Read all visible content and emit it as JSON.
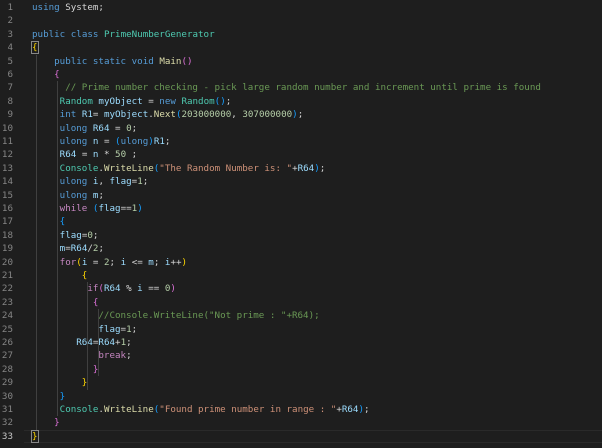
{
  "editor": {
    "line_numbers": [
      "1",
      "2",
      "3",
      "4",
      "5",
      "6",
      "7",
      "8",
      "9",
      "10",
      "11",
      "12",
      "13",
      "14",
      "15",
      "16",
      "17",
      "18",
      "19",
      "20",
      "21",
      "22",
      "23",
      "24",
      "25",
      "26",
      "27",
      "28",
      "29",
      "30",
      "31",
      "32",
      "33"
    ],
    "lines": [
      [
        {
          "t": "using",
          "c": "kw"
        },
        {
          "t": " System;",
          "c": ""
        }
      ],
      [],
      [
        {
          "t": "public",
          "c": "kw"
        },
        {
          "t": " ",
          "c": ""
        },
        {
          "t": "class",
          "c": "kw"
        },
        {
          "t": " ",
          "c": ""
        },
        {
          "t": "PrimeNumberGenerator",
          "c": "type"
        }
      ],
      [
        {
          "t": "{",
          "c": "br1 bracket-box"
        }
      ],
      [
        {
          "t": "    ",
          "c": ""
        },
        {
          "t": "public",
          "c": "kw"
        },
        {
          "t": " ",
          "c": ""
        },
        {
          "t": "static",
          "c": "kw"
        },
        {
          "t": " ",
          "c": ""
        },
        {
          "t": "void",
          "c": "kw"
        },
        {
          "t": " ",
          "c": ""
        },
        {
          "t": "Main",
          "c": "fn"
        },
        {
          "t": "()",
          "c": "br2"
        }
      ],
      [
        {
          "t": "    ",
          "c": ""
        },
        {
          "t": "{",
          "c": "br2"
        }
      ],
      [
        {
          "t": "      ",
          "c": ""
        },
        {
          "t": "// Prime number checking - pick large random number and increment until prime is found",
          "c": "cm"
        }
      ],
      [
        {
          "t": "     ",
          "c": ""
        },
        {
          "t": "Random",
          "c": "type"
        },
        {
          "t": " ",
          "c": ""
        },
        {
          "t": "myObject",
          "c": "var"
        },
        {
          "t": " = ",
          "c": ""
        },
        {
          "t": "new",
          "c": "kw"
        },
        {
          "t": " ",
          "c": ""
        },
        {
          "t": "Random",
          "c": "type"
        },
        {
          "t": "()",
          "c": "br3"
        },
        {
          "t": ";",
          "c": ""
        }
      ],
      [
        {
          "t": "     ",
          "c": ""
        },
        {
          "t": "int",
          "c": "kw"
        },
        {
          "t": " ",
          "c": ""
        },
        {
          "t": "R1",
          "c": "var"
        },
        {
          "t": "= ",
          "c": ""
        },
        {
          "t": "myObject",
          "c": "var"
        },
        {
          "t": ".",
          "c": ""
        },
        {
          "t": "Next",
          "c": "fn"
        },
        {
          "t": "(",
          "c": "br3"
        },
        {
          "t": "203000000",
          "c": "num"
        },
        {
          "t": ", ",
          "c": ""
        },
        {
          "t": "307000000",
          "c": "num"
        },
        {
          "t": ")",
          "c": "br3"
        },
        {
          "t": ";",
          "c": ""
        }
      ],
      [
        {
          "t": "     ",
          "c": ""
        },
        {
          "t": "ulong",
          "c": "kw"
        },
        {
          "t": " ",
          "c": ""
        },
        {
          "t": "R64",
          "c": "var"
        },
        {
          "t": " = ",
          "c": ""
        },
        {
          "t": "0",
          "c": "num"
        },
        {
          "t": ";",
          "c": ""
        }
      ],
      [
        {
          "t": "     ",
          "c": ""
        },
        {
          "t": "ulong",
          "c": "kw"
        },
        {
          "t": " ",
          "c": ""
        },
        {
          "t": "n",
          "c": "var"
        },
        {
          "t": " = ",
          "c": ""
        },
        {
          "t": "(",
          "c": "br3"
        },
        {
          "t": "ulong",
          "c": "kw"
        },
        {
          "t": ")",
          "c": "br3"
        },
        {
          "t": "R1",
          "c": "var"
        },
        {
          "t": ";",
          "c": ""
        }
      ],
      [
        {
          "t": "     ",
          "c": ""
        },
        {
          "t": "R64",
          "c": "var"
        },
        {
          "t": " = ",
          "c": ""
        },
        {
          "t": "n",
          "c": "var"
        },
        {
          "t": " * ",
          "c": ""
        },
        {
          "t": "50",
          "c": "num"
        },
        {
          "t": " ;",
          "c": ""
        }
      ],
      [
        {
          "t": "     ",
          "c": ""
        },
        {
          "t": "Console",
          "c": "type"
        },
        {
          "t": ".",
          "c": ""
        },
        {
          "t": "WriteLine",
          "c": "fn"
        },
        {
          "t": "(",
          "c": "br3"
        },
        {
          "t": "\"The Random Number is: \"",
          "c": "str"
        },
        {
          "t": "+",
          "c": ""
        },
        {
          "t": "R64",
          "c": "var"
        },
        {
          "t": ")",
          "c": "br3"
        },
        {
          "t": ";",
          "c": ""
        }
      ],
      [
        {
          "t": "     ",
          "c": ""
        },
        {
          "t": "ulong",
          "c": "kw"
        },
        {
          "t": " ",
          "c": ""
        },
        {
          "t": "i",
          "c": "var"
        },
        {
          "t": ", ",
          "c": ""
        },
        {
          "t": "flag",
          "c": "var"
        },
        {
          "t": "=",
          "c": ""
        },
        {
          "t": "1",
          "c": "num"
        },
        {
          "t": ";",
          "c": ""
        }
      ],
      [
        {
          "t": "     ",
          "c": ""
        },
        {
          "t": "ulong",
          "c": "kw"
        },
        {
          "t": " ",
          "c": ""
        },
        {
          "t": "m",
          "c": "var"
        },
        {
          "t": ";",
          "c": ""
        }
      ],
      [
        {
          "t": "     ",
          "c": ""
        },
        {
          "t": "while",
          "c": "kw2"
        },
        {
          "t": " ",
          "c": ""
        },
        {
          "t": "(",
          "c": "br3"
        },
        {
          "t": "flag",
          "c": "var"
        },
        {
          "t": "==",
          "c": ""
        },
        {
          "t": "1",
          "c": "num"
        },
        {
          "t": ")",
          "c": "br3"
        }
      ],
      [
        {
          "t": "     ",
          "c": ""
        },
        {
          "t": "{",
          "c": "br3"
        }
      ],
      [
        {
          "t": "     ",
          "c": ""
        },
        {
          "t": "flag",
          "c": "var"
        },
        {
          "t": "=",
          "c": ""
        },
        {
          "t": "0",
          "c": "num"
        },
        {
          "t": ";",
          "c": ""
        }
      ],
      [
        {
          "t": "     ",
          "c": ""
        },
        {
          "t": "m",
          "c": "var"
        },
        {
          "t": "=",
          "c": ""
        },
        {
          "t": "R64",
          "c": "var"
        },
        {
          "t": "/",
          "c": ""
        },
        {
          "t": "2",
          "c": "num"
        },
        {
          "t": ";",
          "c": ""
        }
      ],
      [
        {
          "t": "     ",
          "c": ""
        },
        {
          "t": "for",
          "c": "kw2"
        },
        {
          "t": "(",
          "c": "br1"
        },
        {
          "t": "i",
          "c": "var"
        },
        {
          "t": " = ",
          "c": ""
        },
        {
          "t": "2",
          "c": "num"
        },
        {
          "t": "; ",
          "c": ""
        },
        {
          "t": "i",
          "c": "var"
        },
        {
          "t": " <= ",
          "c": ""
        },
        {
          "t": "m",
          "c": "var"
        },
        {
          "t": "; ",
          "c": ""
        },
        {
          "t": "i",
          "c": "var"
        },
        {
          "t": "++",
          "c": ""
        },
        {
          "t": ")",
          "c": "br1"
        }
      ],
      [
        {
          "t": "         ",
          "c": ""
        },
        {
          "t": "{",
          "c": "br1"
        }
      ],
      [
        {
          "t": "          ",
          "c": ""
        },
        {
          "t": "if",
          "c": "kw2"
        },
        {
          "t": "(",
          "c": "br2"
        },
        {
          "t": "R64",
          "c": "var"
        },
        {
          "t": " % ",
          "c": ""
        },
        {
          "t": "i",
          "c": "var"
        },
        {
          "t": " == ",
          "c": ""
        },
        {
          "t": "0",
          "c": "num"
        },
        {
          "t": ")",
          "c": "br2"
        }
      ],
      [
        {
          "t": "           ",
          "c": ""
        },
        {
          "t": "{",
          "c": "br2"
        }
      ],
      [
        {
          "t": "            ",
          "c": ""
        },
        {
          "t": "//Console.WriteLine(\"Not prime : \"+R64);",
          "c": "cm"
        }
      ],
      [
        {
          "t": "            ",
          "c": ""
        },
        {
          "t": "flag",
          "c": "var"
        },
        {
          "t": "=",
          "c": ""
        },
        {
          "t": "1",
          "c": "num"
        },
        {
          "t": ";",
          "c": ""
        }
      ],
      [
        {
          "t": "        ",
          "c": ""
        },
        {
          "t": "R64",
          "c": "var"
        },
        {
          "t": "=",
          "c": ""
        },
        {
          "t": "R64",
          "c": "var"
        },
        {
          "t": "+",
          "c": ""
        },
        {
          "t": "1",
          "c": "num"
        },
        {
          "t": ";",
          "c": ""
        }
      ],
      [
        {
          "t": "            ",
          "c": ""
        },
        {
          "t": "break",
          "c": "kw2"
        },
        {
          "t": ";",
          "c": ""
        }
      ],
      [
        {
          "t": "           ",
          "c": ""
        },
        {
          "t": "}",
          "c": "br2"
        }
      ],
      [
        {
          "t": "         ",
          "c": ""
        },
        {
          "t": "}",
          "c": "br1"
        }
      ],
      [
        {
          "t": "     ",
          "c": ""
        },
        {
          "t": "}",
          "c": "br3"
        }
      ],
      [
        {
          "t": "     ",
          "c": ""
        },
        {
          "t": "Console",
          "c": "type"
        },
        {
          "t": ".",
          "c": ""
        },
        {
          "t": "WriteLine",
          "c": "fn"
        },
        {
          "t": "(",
          "c": "br3"
        },
        {
          "t": "\"Found prime number in range : \"",
          "c": "str"
        },
        {
          "t": "+",
          "c": ""
        },
        {
          "t": "R64",
          "c": "var"
        },
        {
          "t": ")",
          "c": "br3"
        },
        {
          "t": ";",
          "c": ""
        }
      ],
      [
        {
          "t": "    ",
          "c": ""
        },
        {
          "t": "}",
          "c": "br2"
        }
      ],
      [
        {
          "t": "}",
          "c": "br1 bracket-box"
        }
      ]
    ],
    "active_line": 33
  }
}
